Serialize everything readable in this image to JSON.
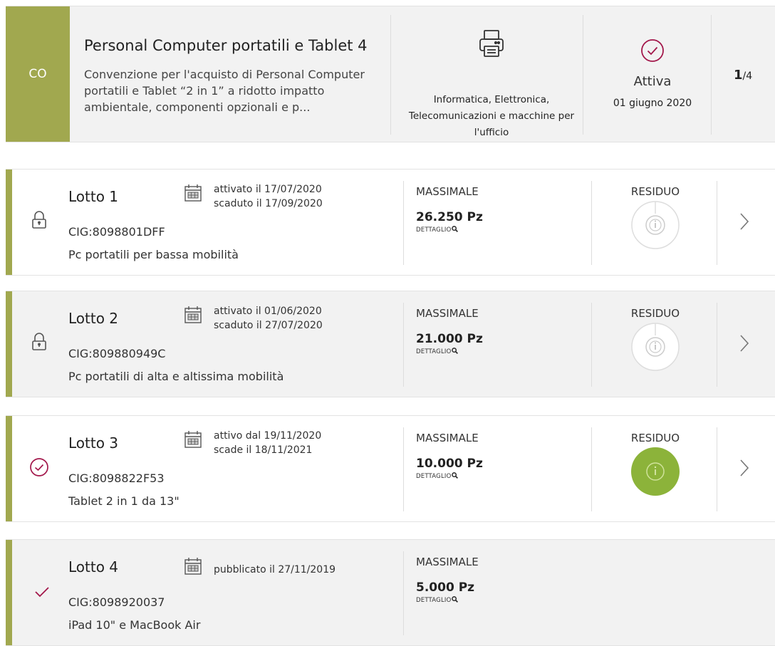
{
  "header": {
    "badge": "CO",
    "title": "Personal Computer portatili e Tablet 4",
    "description": "Convenzione per l'acquisto di Personal Computer portatili e Tablet “2 in 1” a ridotto impatto ambientale, componenti opzionali e p...",
    "category_icon": "printer-icon",
    "category": "Informatica, Elettronica, Telecomunicazioni e macchine per l'ufficio",
    "status_icon": "check-circle-icon",
    "status": "Attiva",
    "status_date": "01 giugno 2020",
    "page_current": "1",
    "page_total": "/4"
  },
  "accent_color": "#a1a84f",
  "residuo_active_color": "#8cb33a",
  "lotti": [
    {
      "name": "Lotto 1",
      "status_icon": "lock-icon",
      "date_line1": "attivato il 17/07/2020",
      "date_line2": "scaduto il 17/09/2020",
      "cig": "CIG:8098801DFF",
      "description": "Pc portatili per bassa mobilità",
      "massimale_label": "MASSIMALE",
      "massimale_value": "26.250 Pz",
      "detail_label": "DETTAGLIO",
      "residuo_label": "RESIDUO"
    },
    {
      "name": "Lotto 2",
      "status_icon": "lock-icon",
      "date_line1": "attivato il 01/06/2020",
      "date_line2": "scaduto il 27/07/2020",
      "cig": "CIG:809880949C",
      "description": "Pc portatili di alta e altissima mobilità",
      "massimale_label": "MASSIMALE",
      "massimale_value": "21.000 Pz",
      "detail_label": "DETTAGLIO",
      "residuo_label": "RESIDUO"
    },
    {
      "name": "Lotto 3",
      "status_icon": "check-circle-icon",
      "date_line1": "attivo dal 19/11/2020",
      "date_line2": "scade il 18/11/2021",
      "cig": "CIG:8098822F53",
      "description": "Tablet 2 in 1 da 13\"",
      "massimale_label": "MASSIMALE",
      "massimale_value": "10.000 Pz",
      "detail_label": "DETTAGLIO",
      "residuo_label": "RESIDUO"
    },
    {
      "name": "Lotto 4",
      "status_icon": "checkmark-icon",
      "date_line1": "pubblicato il 27/11/2019",
      "cig": "CIG:8098920037",
      "description": "iPad 10\" e MacBook Air",
      "massimale_label": "MASSIMALE",
      "massimale_value": "5.000 Pz",
      "detail_label": "DETTAGLIO"
    }
  ]
}
